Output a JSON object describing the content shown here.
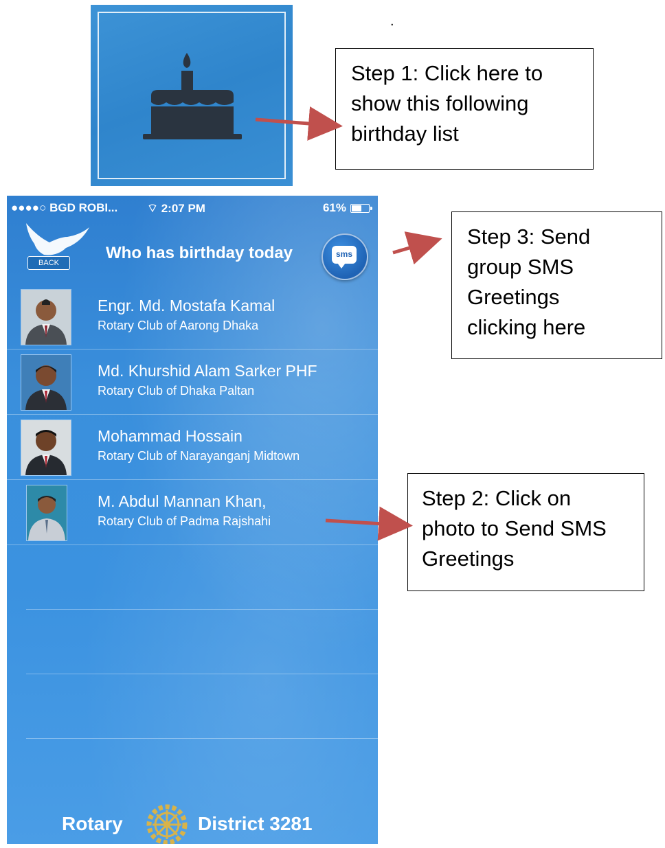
{
  "dot": ".",
  "callouts": {
    "step1": [
      "Step 1: Click here to",
      "show this following",
      "birthday list"
    ],
    "step3": [
      "Step 3: Send",
      "group SMS",
      "Greetings",
      "clicking here"
    ],
    "step2": [
      "Step 2: Click on",
      "photo to Send SMS",
      "Greetings"
    ]
  },
  "status_bar": {
    "carrier": "●●●●○ BGD ROBI...",
    "time": "2:07 PM",
    "battery": "61%"
  },
  "header": {
    "back_label": "BACK",
    "title": "Who has birthday today",
    "sms_label": "sms"
  },
  "birthdays": [
    {
      "name": "Engr. Md. Mostafa  Kamal",
      "club": "Rotary Club of Aarong Dhaka"
    },
    {
      "name": "Md. Khurshid Alam Sarker PHF",
      "club": "Rotary Club of Dhaka Paltan"
    },
    {
      "name": "Mohammad  Hossain",
      "club": "Rotary Club of Narayanganj Midtown"
    },
    {
      "name": "M. Abdul Mannan Khan,",
      "club": "Rotary Club of Padma Rajshahi"
    }
  ],
  "footer": {
    "left": "Rotary",
    "right": "District 3281"
  },
  "colors": {
    "phone_blue": "#3a8fdc",
    "arrow_red": "#c0504d",
    "cake_icon": "#2a3440"
  }
}
